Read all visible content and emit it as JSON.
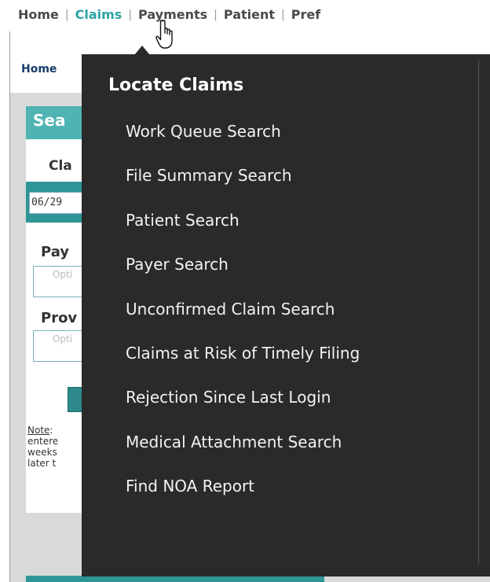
{
  "topnav": {
    "items": [
      "Home",
      "Claims",
      "Payments",
      "Patient",
      "Pref"
    ],
    "separator": "|",
    "active_color": "#2ba3a3"
  },
  "breadcrumb": "Home",
  "search_panel": {
    "title": "Sea",
    "claim_label": "Cla",
    "date_value": "06/29",
    "payer_label": "Pay",
    "payer_placeholder": "Opti",
    "provider_label": "Prov",
    "provider_placeholder": "Opti",
    "note_label": "Note",
    "note_lines": [
      ": ",
      "entere",
      "weeks",
      "later t"
    ]
  },
  "dropdown": {
    "title": "Locate Claims",
    "items": [
      "Work Queue Search",
      "File Summary Search",
      "Patient Search",
      "Payer Search",
      "Unconfirmed Claim Search",
      "Claims at Risk of Timely Filing",
      "Rejection Since Last Login",
      "Medical Attachment Search",
      "Find NOA Report"
    ]
  },
  "colors": {
    "accent": "#4fb3b3",
    "dropdown_bg": "#2a2a2a",
    "nav_text": "#4a4a4a",
    "breadcrumb": "#163c6c"
  },
  "icons": {
    "cursor": "hand-pointer-icon"
  }
}
